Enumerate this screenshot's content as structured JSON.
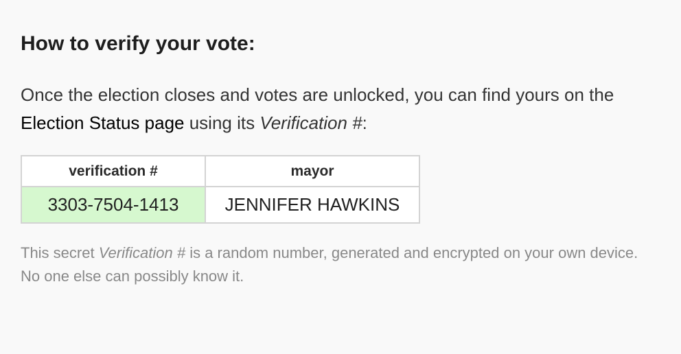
{
  "heading": "How to verify your vote:",
  "intro": {
    "part1": "Once the election closes and votes are unlocked, you can find yours on the ",
    "link_text": "Election Status page",
    "part2": " using its ",
    "em_text": "Verification #",
    "part3": ":"
  },
  "table": {
    "headers": [
      "verification #",
      "mayor"
    ],
    "rows": [
      [
        "3303-7504-1413",
        "JENNIFER HAWKINS"
      ]
    ],
    "highlight_color": "#d6f8cf"
  },
  "note": {
    "part1": "This secret ",
    "em_text": "Verification #",
    "part2": " is a random number, generated and encrypted on your own device.",
    "line2": "No one else can possibly know it."
  }
}
